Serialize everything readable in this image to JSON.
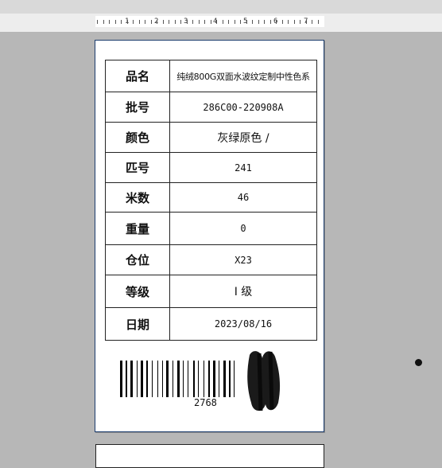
{
  "ruler": {
    "numbers": [
      "1",
      "2",
      "3",
      "4",
      "5",
      "6",
      "7"
    ]
  },
  "label": {
    "rows": [
      {
        "key": "品名",
        "value": "纯绒800G双面水波纹定制中性色系"
      },
      {
        "key": "批号",
        "value": "286C00-220908A"
      },
      {
        "key": "颜色",
        "value": "灰绿原色 /"
      },
      {
        "key": "匹号",
        "value": "241"
      },
      {
        "key": "米数",
        "value": "46"
      },
      {
        "key": "重量",
        "value": "0"
      },
      {
        "key": "仓位",
        "value": "X23"
      },
      {
        "key": "等级",
        "value": "I 级"
      },
      {
        "key": "日期",
        "value": "2023/08/16"
      }
    ],
    "barcode_text": "2768"
  },
  "colors": {
    "background": "#b7b7b7",
    "page": "#ffffff",
    "page_border": "#1c3d6e"
  }
}
